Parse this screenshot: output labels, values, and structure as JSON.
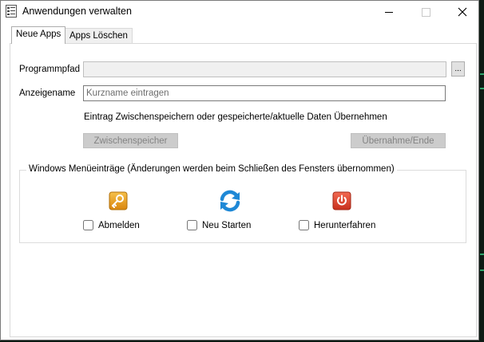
{
  "window": {
    "title": "Anwendungen verwalten",
    "close_glyph": "✕"
  },
  "tabs": [
    {
      "label": "Neue Apps",
      "active": true
    },
    {
      "label": "Apps Löschen",
      "active": false
    }
  ],
  "form": {
    "program_path_label": "Programmpfad",
    "program_path_value": "",
    "browse_label": "...",
    "display_name_label": "Anzeigename",
    "display_name_placeholder": "Kurzname eintragen",
    "hint": "Eintrag Zwischenspeichern oder gespeicherte/aktuelle Daten Übernehmen",
    "cache_button": "Zwischenspeicher",
    "apply_button": "Übernahme/Ende"
  },
  "menu_group": {
    "title": "Windows Menüeinträge (Änderungen werden beim Schließen des Fensters übernommen)",
    "items": [
      {
        "label": "Abmelden",
        "icon": "key-icon",
        "color": "#e8a21f",
        "checked": false
      },
      {
        "label": "Neu Starten",
        "icon": "refresh-icon",
        "color": "#1e88d6",
        "checked": false
      },
      {
        "label": "Herunterfahren",
        "icon": "power-icon",
        "color": "#e2452f",
        "checked": false
      }
    ]
  },
  "colors": {
    "console_bg": "#0d1b14",
    "console_accent": "#2ea36a"
  }
}
